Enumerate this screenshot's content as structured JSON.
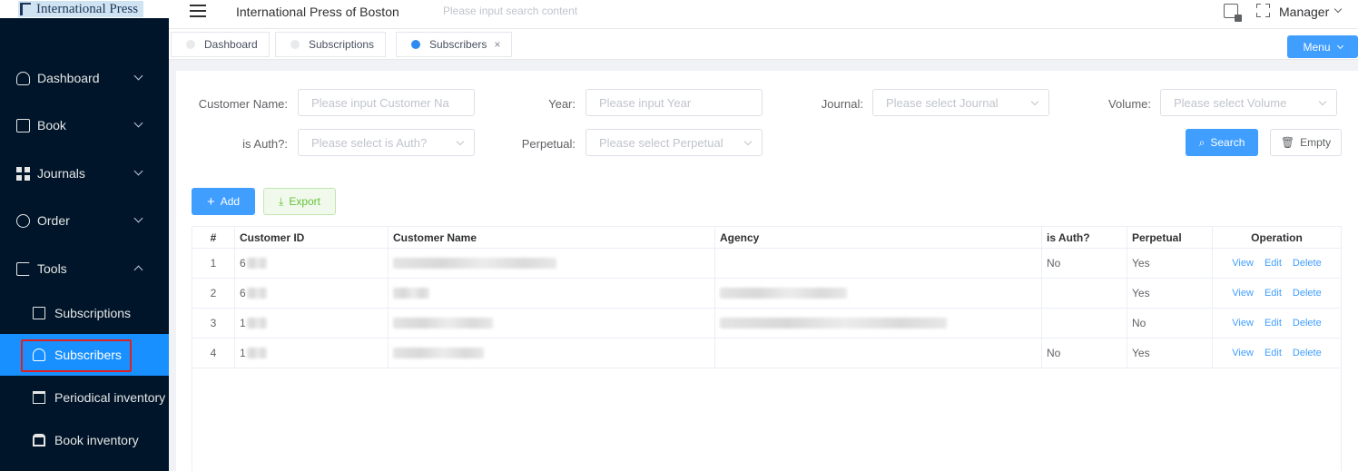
{
  "sidebar": {
    "logo_text": "International Press",
    "items": [
      {
        "label": "Dashboard",
        "icon": "user-icon"
      },
      {
        "label": "Book",
        "icon": "book-icon"
      },
      {
        "label": "Journals",
        "icon": "grid-icon"
      },
      {
        "label": "Order",
        "icon": "order-icon"
      },
      {
        "label": "Tools",
        "icon": "tools-icon"
      }
    ],
    "subitems": [
      {
        "label": "Subscriptions",
        "icon": "edit-doc-icon"
      },
      {
        "label": "Subscribers",
        "icon": "person-icon",
        "active": true
      },
      {
        "label": "Periodical inventory",
        "icon": "box-icon"
      },
      {
        "label": "Book inventory",
        "icon": "bank-icon"
      }
    ]
  },
  "header": {
    "title": "International Press of Boston",
    "search_placeholder": "Please input search content",
    "user": "Manager"
  },
  "tags": [
    {
      "label": "Dashboard"
    },
    {
      "label": "Subscriptions"
    },
    {
      "label": "Subscribers",
      "active": true
    }
  ],
  "menu_button": "Menu",
  "filters": {
    "customer_name": {
      "label": "Customer Name:",
      "placeholder": "Please input Customer Na"
    },
    "year": {
      "label": "Year:",
      "placeholder": "Please input Year"
    },
    "journal": {
      "label": "Journal:",
      "placeholder": "Please select Journal"
    },
    "volume": {
      "label": "Volume:",
      "placeholder": "Please select Volume"
    },
    "is_auth": {
      "label": "is Auth?:",
      "placeholder": "Please select is Auth?"
    },
    "perpetual": {
      "label": "Perpetual:",
      "placeholder": "Please select Perpetual"
    },
    "search_button": "Search",
    "empty_button": "Empty"
  },
  "actions": {
    "add": "Add",
    "export": "Export"
  },
  "table": {
    "columns": [
      "#",
      "Customer ID",
      "Customer Name",
      "Agency",
      "is Auth?",
      "Perpetual",
      "Operation"
    ],
    "rows": [
      {
        "index": "1",
        "id": "6",
        "auth": "No",
        "perpetual": "Yes"
      },
      {
        "index": "2",
        "id": "6",
        "auth": "",
        "perpetual": "Yes"
      },
      {
        "index": "3",
        "id": "1",
        "auth": "",
        "perpetual": "No"
      },
      {
        "index": "4",
        "id": "1",
        "auth": "No",
        "perpetual": "Yes"
      }
    ],
    "ops": {
      "view": "View",
      "edit": "Edit",
      "delete": "Delete"
    }
  }
}
